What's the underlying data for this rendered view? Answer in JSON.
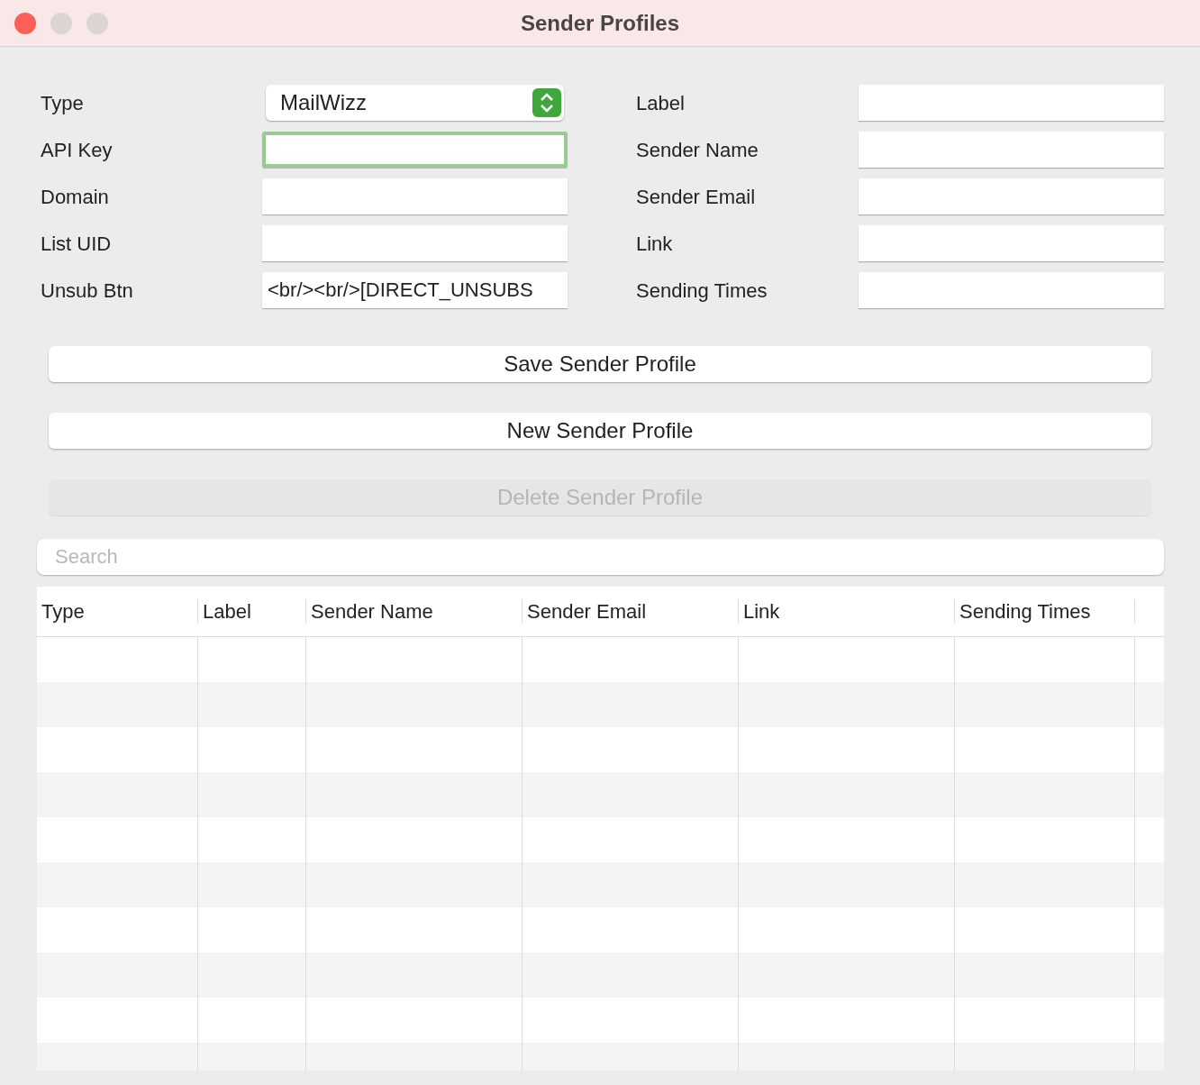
{
  "window": {
    "title": "Sender Profiles"
  },
  "left_fields": [
    {
      "label": "Type",
      "kind": "select",
      "value": "MailWizz"
    },
    {
      "label": "API Key",
      "kind": "text",
      "focused": true
    },
    {
      "label": "Domain",
      "kind": "text",
      "focused": false
    },
    {
      "label": "List UID",
      "kind": "text",
      "focused": false
    },
    {
      "label": "Unsub Btn",
      "kind": "text",
      "value": "<br/><br/>[DIRECT_UNSUBS",
      "focused": false
    }
  ],
  "right_fields": [
    {
      "label": "Label",
      "kind": "text",
      "focused": false
    },
    {
      "label": "Sender Name",
      "kind": "text",
      "focused": false
    },
    {
      "label": "Sender Email",
      "kind": "text",
      "focused": false
    },
    {
      "label": "Link",
      "kind": "text",
      "focused": false
    },
    {
      "label": "Sending Times",
      "kind": "text",
      "focused": false
    }
  ],
  "buttons": [
    {
      "label": "Save Sender Profile",
      "disabled": false
    },
    {
      "label": "New Sender Profile",
      "disabled": false
    },
    {
      "label": "Delete Sender Profile",
      "disabled": true
    }
  ],
  "search": {
    "placeholder": "Search"
  },
  "table": {
    "columns": [
      "Type",
      "Label",
      "Sender Name",
      "Sender Email",
      "Link",
      "Sending Times"
    ]
  }
}
